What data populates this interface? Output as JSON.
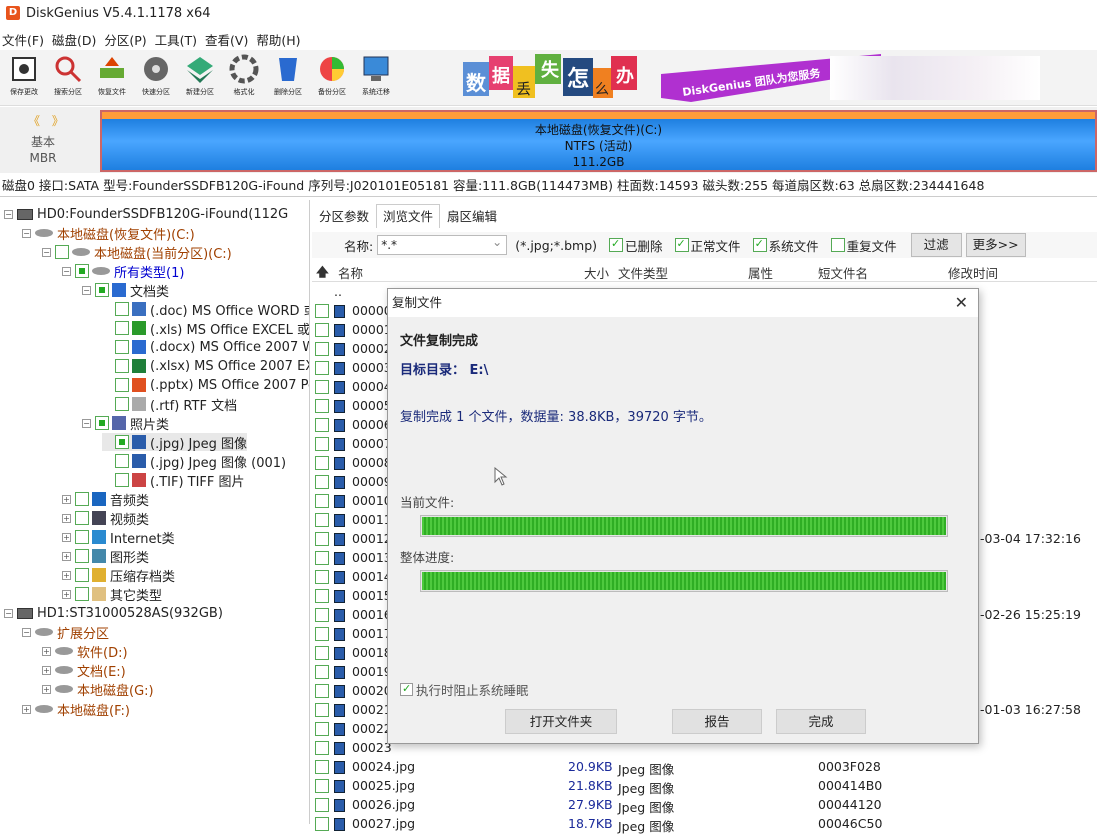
{
  "window": {
    "title": "DiskGenius V5.4.1.1178 x64"
  },
  "menu": [
    "文件(F)",
    "磁盘(D)",
    "分区(P)",
    "工具(T)",
    "查看(V)",
    "帮助(H)"
  ],
  "toolbar": [
    "保存更改",
    "搜索分区",
    "恢复文件",
    "快速分区",
    "新建分区",
    "格式化",
    "删除分区",
    "备份分区",
    "系统迁移"
  ],
  "banner": {
    "chars": [
      "数",
      "据",
      "丢",
      "失",
      "怎",
      "么",
      "办"
    ],
    "slogan": "DiskGenius 团队为您服务"
  },
  "disk_strip": {
    "nav": "《 》",
    "type1": "基本",
    "type2": "MBR",
    "partition_name": "本地磁盘(恢复文件)(C:)",
    "fs": "NTFS (活动)",
    "size": "111.2GB"
  },
  "disk_info": "磁盘0 接口:SATA  型号:FounderSSDFB120G-iFound  序列号:J020101E05181  容量:111.8GB(114473MB)  柱面数:14593  磁头数:255  每道扇区数:63  总扇区数:234441648",
  "tree": [
    {
      "label": "HD0:FounderSSDFB120G-iFound(112G",
      "cls": ""
    },
    {
      "label": "本地磁盘(恢复文件)(C:)",
      "cls": "orange"
    },
    {
      "label": "本地磁盘(当前分区)(C:)",
      "cls": "orange"
    },
    {
      "label": "所有类型(1)",
      "cls": "blue"
    },
    {
      "label": "文档类",
      "cls": ""
    },
    {
      "label": "(.doc) MS Office WORD 或",
      "cls": ""
    },
    {
      "label": "(.xls) MS Office EXCEL 或 W",
      "cls": ""
    },
    {
      "label": "(.docx) MS Office 2007 WC",
      "cls": ""
    },
    {
      "label": "(.xlsx) MS Office 2007 EXC",
      "cls": ""
    },
    {
      "label": "(.pptx) MS Office 2007 Pov",
      "cls": ""
    },
    {
      "label": "(.rtf) RTF 文档",
      "cls": ""
    },
    {
      "label": "照片类",
      "cls": ""
    },
    {
      "label": "(.jpg) Jpeg 图像",
      "cls": ""
    },
    {
      "label": "(.jpg) Jpeg 图像 (001)",
      "cls": ""
    },
    {
      "label": "(.TIF) TIFF 图片",
      "cls": ""
    },
    {
      "label": "音频类",
      "cls": ""
    },
    {
      "label": "视频类",
      "cls": ""
    },
    {
      "label": "Internet类",
      "cls": ""
    },
    {
      "label": "图形类",
      "cls": ""
    },
    {
      "label": "压缩存档类",
      "cls": ""
    },
    {
      "label": "其它类型",
      "cls": ""
    },
    {
      "label": "HD1:ST31000528AS(932GB)",
      "cls": ""
    },
    {
      "label": "扩展分区",
      "cls": "orange"
    },
    {
      "label": "软件(D:)",
      "cls": "orange"
    },
    {
      "label": "文档(E:)",
      "cls": "orange"
    },
    {
      "label": "本地磁盘(G:)",
      "cls": "orange"
    },
    {
      "label": "本地磁盘(F:)",
      "cls": "orange"
    }
  ],
  "tabs": [
    "分区参数",
    "浏览文件",
    "扇区编辑"
  ],
  "filter": {
    "name_label": "名称:",
    "name_value": "*.*",
    "hint": "(*.jpg;*.bmp)",
    "deleted": "已删除",
    "normal": "正常文件",
    "system": "系统文件",
    "duplicate": "重复文件",
    "filter_btn": "过滤",
    "more_btn": "更多>>"
  },
  "columns": {
    "up": "🡅",
    "name": "名称",
    "size": "大小",
    "type": "文件类型",
    "attr": "属性",
    "short": "短文件名",
    "modified": "修改时间"
  },
  "files": [
    {
      "name": "..",
      "size": "",
      "type": "",
      "short": "",
      "time": ""
    },
    {
      "name": "00000",
      "size": "",
      "type": "",
      "short": "",
      "time": ""
    },
    {
      "name": "00001",
      "size": "",
      "type": "",
      "short": "",
      "time": ""
    },
    {
      "name": "00002",
      "size": "",
      "type": "",
      "short": "",
      "time": ""
    },
    {
      "name": "00003",
      "size": "",
      "type": "",
      "short": "",
      "time": ""
    },
    {
      "name": "00004",
      "size": "",
      "type": "",
      "short": "",
      "time": ""
    },
    {
      "name": "00005",
      "size": "",
      "type": "",
      "short": "",
      "time": ""
    },
    {
      "name": "00006",
      "size": "",
      "type": "",
      "short": "",
      "time": ""
    },
    {
      "name": "00007",
      "size": "",
      "type": "",
      "short": "",
      "time": ""
    },
    {
      "name": "00008",
      "size": "",
      "type": "",
      "short": "",
      "time": ""
    },
    {
      "name": "00009",
      "size": "",
      "type": "",
      "short": "",
      "time": ""
    },
    {
      "name": "00010",
      "size": "",
      "type": "",
      "short": "",
      "time": ""
    },
    {
      "name": "00011",
      "size": "",
      "type": "",
      "short": "",
      "time": ""
    },
    {
      "name": "00012",
      "size": "",
      "type": "",
      "short": "",
      "time": "-03-04 17:32:16"
    },
    {
      "name": "00013",
      "size": "",
      "type": "",
      "short": "",
      "time": ""
    },
    {
      "name": "00014",
      "size": "",
      "type": "",
      "short": "",
      "time": ""
    },
    {
      "name": "00015",
      "size": "",
      "type": "",
      "short": "",
      "time": ""
    },
    {
      "name": "00016",
      "size": "",
      "type": "",
      "short": "",
      "time": "-02-26 15:25:19"
    },
    {
      "name": "00017",
      "size": "",
      "type": "",
      "short": "",
      "time": ""
    },
    {
      "name": "00018",
      "size": "",
      "type": "",
      "short": "",
      "time": ""
    },
    {
      "name": "00019",
      "size": "",
      "type": "",
      "short": "",
      "time": ""
    },
    {
      "name": "00020",
      "size": "",
      "type": "",
      "short": "",
      "time": ""
    },
    {
      "name": "00021",
      "size": "",
      "type": "",
      "short": "",
      "time": "-01-03 16:27:58"
    },
    {
      "name": "00022",
      "size": "",
      "type": "",
      "short": "",
      "time": ""
    },
    {
      "name": "00023",
      "size": "",
      "type": "",
      "short": "",
      "time": ""
    },
    {
      "name": "00024.jpg",
      "size": "20.9KB",
      "type": "Jpeg 图像",
      "short": "0003F028",
      "time": ""
    },
    {
      "name": "00025.jpg",
      "size": "21.8KB",
      "type": "Jpeg 图像",
      "short": "000414B0",
      "time": ""
    },
    {
      "name": "00026.jpg",
      "size": "27.9KB",
      "type": "Jpeg 图像",
      "short": "00044120",
      "time": ""
    },
    {
      "name": "00027.jpg",
      "size": "18.7KB",
      "type": "Jpeg 图像",
      "short": "00046C50",
      "time": ""
    }
  ],
  "dialog": {
    "title": "复制文件",
    "close": "✕",
    "heading": "文件复制完成",
    "target": "目标目录：  E:\\",
    "summary": "复制完成 1 个文件，数据量: 38.8KB，39720 字节。",
    "current_label": "当前文件:",
    "overall_label": "整体进度:",
    "current_progress": 1.0,
    "overall_progress": 1.0,
    "prevent_sleep": "执行时阻止系统睡眠",
    "btn_open": "打开文件夹",
    "btn_report": "报告",
    "btn_done": "完成"
  }
}
